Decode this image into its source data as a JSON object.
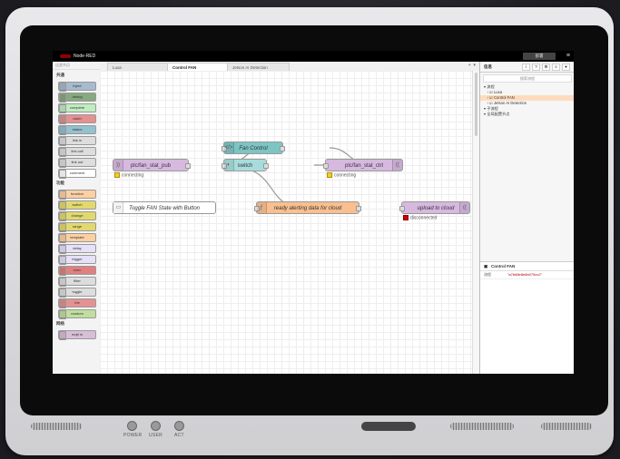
{
  "header": {
    "app_name": "Node-RED",
    "deploy_label": "部署",
    "menu_icon": "hamburger-icon"
  },
  "palette": {
    "search_placeholder": "过滤节点",
    "categories": [
      {
        "name": "共通",
        "nodes": [
          "inject",
          "debug",
          "complete",
          "catch",
          "status",
          "link in",
          "link call",
          "link out",
          "comment"
        ]
      },
      {
        "name": "功能",
        "nodes": [
          "function",
          "switch",
          "change",
          "range",
          "template",
          "delay",
          "trigger",
          "exec",
          "filter",
          "toggle",
          "rbe",
          "random"
        ]
      },
      {
        "name": "网络",
        "nodes": [
          "mqtt in"
        ]
      }
    ],
    "colors": [
      "#a6bbcf",
      "#87a980",
      "#c0edc0",
      "#e49191",
      "#94c1d0",
      "#dddddd",
      "#dddddd",
      "#dddddd",
      "#ffffff",
      "#fdd0a2",
      "#e2d96e",
      "#e2d96e",
      "#e2d96e",
      "#fdd0a2",
      "#e6e0f8",
      "#e6e0f8",
      "#e08080",
      "#dddddd",
      "#dddddd",
      "#e49191",
      "#c0de9e",
      "#d8bfd8"
    ]
  },
  "workspace": {
    "tabs": [
      "Luxa",
      "Control FAN",
      "Jetson AI Detection"
    ],
    "active_tab": 1,
    "add_icon": "+"
  },
  "flow": {
    "nodes": {
      "pub": {
        "label": "plc/fan_stat_pub",
        "status": "connecting"
      },
      "fan_control": {
        "label": "Fan Control"
      },
      "switch": {
        "label": "switch"
      },
      "ctrl": {
        "label": "plc/fan_stat_ctrl",
        "status": "connecting"
      },
      "comment": {
        "label": "Toggle FAN State with Button"
      },
      "alerting": {
        "label": "ready alerting data for cloud"
      },
      "upload": {
        "label": "upload to cloud",
        "status": "disconnected"
      }
    }
  },
  "sidebar": {
    "tab_label": "信息",
    "search_placeholder": "搜索流程",
    "tree": [
      {
        "label": "流程",
        "selected": false
      },
      {
        "label": "Luxa",
        "selected": false
      },
      {
        "label": "Control FAN",
        "selected": true
      },
      {
        "label": "Jetson AI Detection",
        "selected": false
      },
      {
        "label": "子流程",
        "selected": false
      },
      {
        "label": "全局配置节点",
        "selected": false
      }
    ],
    "info": {
      "title": "Control FAN",
      "key": "流程",
      "value": "\"a7b68e8e8b079cc2\""
    }
  },
  "device": {
    "leds": [
      "POWER",
      "USER",
      "ACT"
    ]
  }
}
